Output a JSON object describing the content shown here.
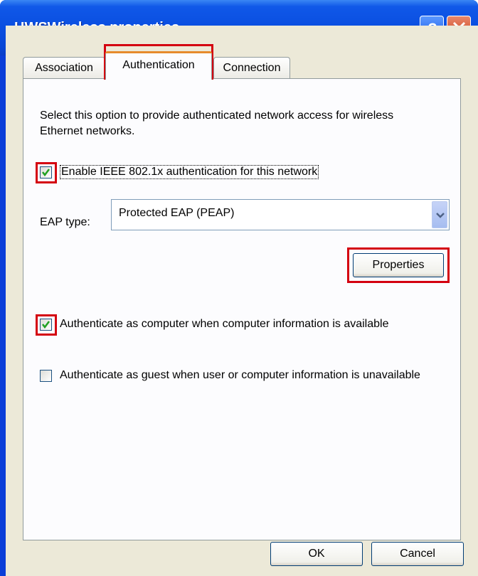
{
  "window": {
    "title": "HWSWireless properties",
    "help_button": "?",
    "close_button": "close"
  },
  "tabs": [
    {
      "label": "Association"
    },
    {
      "label": "Authentication",
      "selected": true
    },
    {
      "label": "Connection"
    }
  ],
  "authentication": {
    "description": "Select this option to provide authenticated network access for wireless Ethernet networks.",
    "enable_8021x": {
      "label": "Enable IEEE 802.1x authentication for this network",
      "checked": true
    },
    "eap_type": {
      "label": "EAP type:",
      "value": "Protected EAP (PEAP)"
    },
    "properties_button": "Properties",
    "auth_as_computer": {
      "label": "Authenticate as computer when computer information is available",
      "checked": true
    },
    "auth_as_guest": {
      "label": "Authenticate as guest when user or computer information is unavailable",
      "checked": false
    }
  },
  "footer": {
    "ok_label": "OK",
    "cancel_label": "Cancel"
  },
  "colors": {
    "titlebar": "#0a4ee0",
    "highlight": "#d40010",
    "dialog_bg": "#ece9d8"
  }
}
